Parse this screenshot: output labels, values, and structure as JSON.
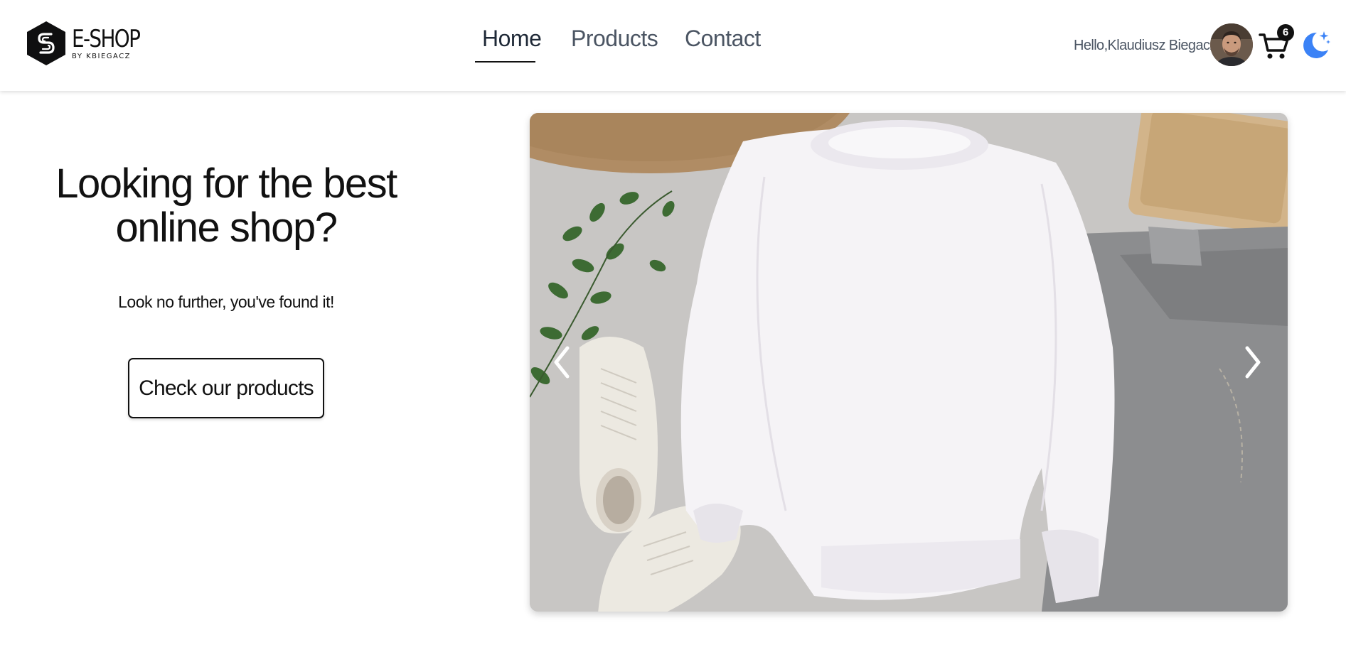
{
  "brand": {
    "title": "E-SHOP",
    "subtitle": "BY KBIEGACZ"
  },
  "nav": {
    "items": [
      {
        "label": "Home",
        "active": true
      },
      {
        "label": "Products",
        "active": false
      },
      {
        "label": "Contact",
        "active": false
      }
    ]
  },
  "user": {
    "greeting": "Hello,Klaudiusz Biegacz",
    "cart_count": "6"
  },
  "icons": {
    "logo": "hexagon-logo-icon",
    "cart": "shopping-cart-icon",
    "theme": "moon-icon",
    "prev": "chevron-left-icon",
    "next": "chevron-right-icon"
  },
  "hero": {
    "title": "Looking for the best online shop?",
    "subtitle": "Look no further, you've found it!",
    "cta_label": "Check our products"
  },
  "colors": {
    "accent": "#3b82f6",
    "text": "#111111",
    "muted": "#4b5563"
  }
}
